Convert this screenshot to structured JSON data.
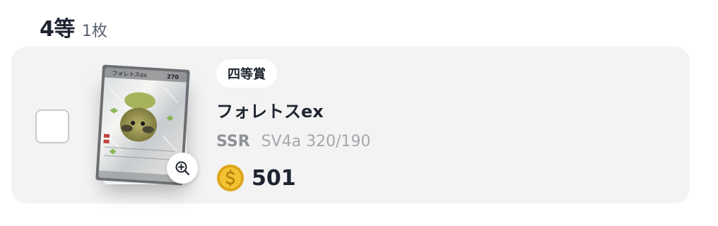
{
  "section": {
    "grade": "4等",
    "count": "1枚"
  },
  "item": {
    "prize_label": "四等賞",
    "name": "フォレトスex",
    "rarity": "SSR",
    "set_code": "SV4a 320/190",
    "price": "501",
    "card_hp": "270",
    "card_title": "フォレトスex",
    "selected": false
  },
  "colors": {
    "row_background": "#f3f3f3",
    "coin_gold": "#f2c230",
    "text_dark": "#1e2430",
    "text_muted": "#a5a8ae"
  },
  "icons": {
    "zoom": "zoom-in-icon",
    "coin": "coin-icon"
  }
}
